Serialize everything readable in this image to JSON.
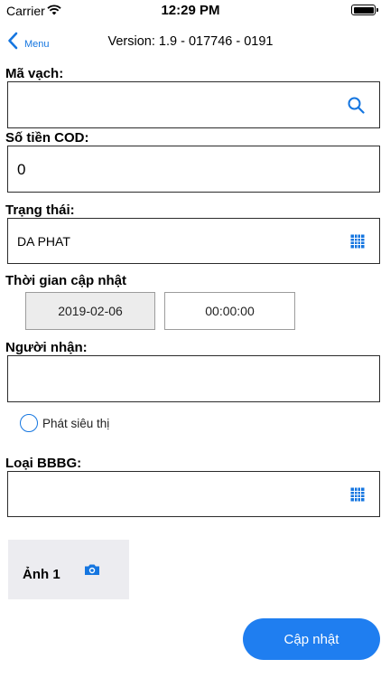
{
  "status_bar": {
    "carrier": "Carrier",
    "time": "12:29 PM"
  },
  "nav": {
    "back_label": "Menu",
    "title": "Version: 1.9 - 017746 - 0191"
  },
  "form": {
    "barcode": {
      "label": "Mã vạch:",
      "value": ""
    },
    "cod": {
      "label": "Số tiền COD:",
      "value": "0"
    },
    "status": {
      "label": "Trạng thái:",
      "value": "DA PHAT"
    },
    "update_time": {
      "label": "Thời gian cập nhật",
      "date": "2019-02-06",
      "time": "00:00:00"
    },
    "recipient": {
      "label": "Người nhận:",
      "value": ""
    },
    "supermarket": {
      "label": "Phát siêu thị",
      "checked": false
    },
    "bbbg_type": {
      "label": "Loại BBBG:",
      "value": ""
    }
  },
  "photo": {
    "label": "Ảnh 1"
  },
  "actions": {
    "update_label": "Cập nhật"
  },
  "colors": {
    "accent": "#1576e0",
    "button": "#1f7ef0",
    "photo_bg": "#ececf0",
    "date_bg": "#ececec"
  }
}
